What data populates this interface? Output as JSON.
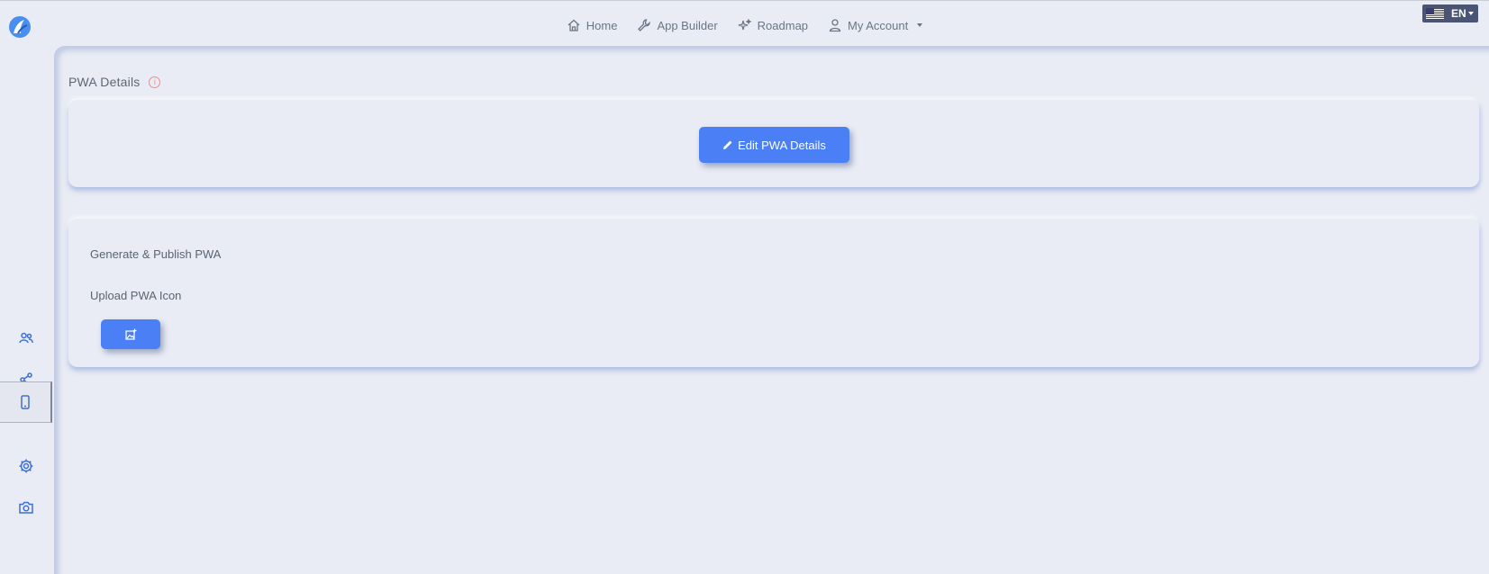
{
  "nav": {
    "items": [
      {
        "label": "Home",
        "icon": "home-icon"
      },
      {
        "label": "App Builder",
        "icon": "wrench-icon"
      },
      {
        "label": "Roadmap",
        "icon": "sparkles-icon"
      },
      {
        "label": "My Account",
        "icon": "user-icon"
      }
    ]
  },
  "language": {
    "code": "EN",
    "flag": "us-flag-icon"
  },
  "sidebar": {
    "items": [
      {
        "icon": "users-icon"
      },
      {
        "icon": "share-icon"
      },
      {
        "icon": "mobile-icon",
        "active": true
      },
      {
        "icon": "gear-icon"
      },
      {
        "icon": "camera-icon"
      }
    ]
  },
  "main": {
    "title": "PWA Details",
    "edit_button": "Edit PWA Details",
    "generate_label": "Generate & Publish PWA",
    "upload_label": "Upload PWA Icon"
  },
  "colors": {
    "accent": "#4a7ff5",
    "background": "#e9ecf4",
    "icon": "#3d6fd6"
  }
}
